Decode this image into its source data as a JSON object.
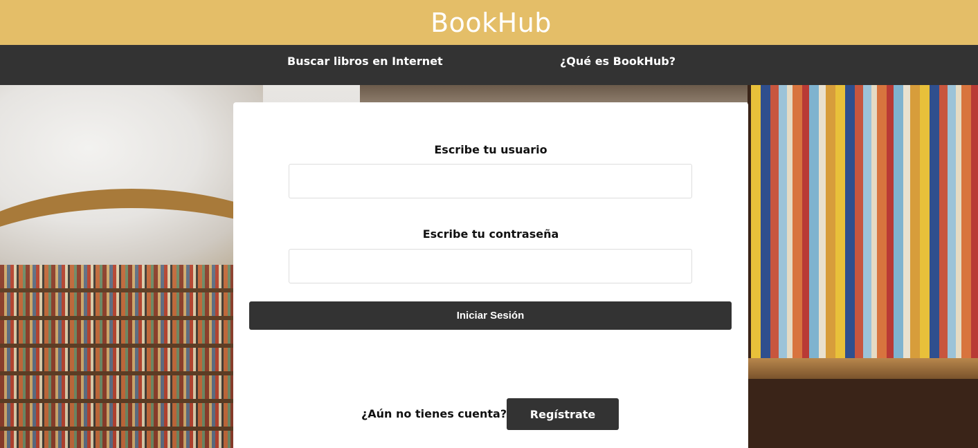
{
  "header": {
    "brand": "BookHub"
  },
  "nav": {
    "items": [
      {
        "label": "Buscar libros en Internet"
      },
      {
        "label": "¿Qué es BookHub?"
      }
    ]
  },
  "login": {
    "username_label": "Escribe tu usuario",
    "username_value": "",
    "password_label": "Escribe tu contraseña",
    "password_value": "",
    "submit_label": "Iniciar Sesión"
  },
  "register": {
    "question": "¿Aún no tienes cuenta?",
    "button_label": "Regístrate"
  },
  "colors": {
    "header_bg": "#e4be68",
    "nav_bg": "#333333",
    "card_bg": "#ffffff",
    "button_bg": "#333333"
  }
}
